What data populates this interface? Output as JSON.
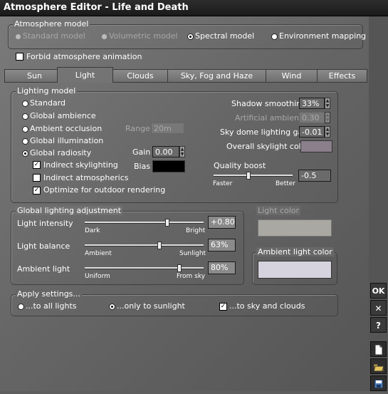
{
  "window": {
    "title": "Atmosphere Editor - Life and Death"
  },
  "atmosphere_model": {
    "label": "Atmosphere model",
    "options": [
      "Standard model",
      "Volumetric model",
      "Spectral model",
      "Environment mapping"
    ],
    "selected": "Spectral model"
  },
  "forbid_animation": {
    "label": "Forbid atmosphere animation",
    "checked": false
  },
  "tabs": [
    "Sun",
    "Light",
    "Clouds",
    "Sky, Fog and Haze",
    "Wind",
    "Effects"
  ],
  "active_tab": "Light",
  "lighting_model": {
    "label": "Lighting model",
    "options": [
      "Standard",
      "Global ambience",
      "Ambient occlusion",
      "Global illumination",
      "Global radiosity"
    ],
    "selected": "Global radiosity",
    "range_label": "Range",
    "range_value": "20m",
    "gain_label": "Gain",
    "gain_value": "0.00",
    "bias_label": "Bias",
    "bias_color": "#000000",
    "checks": [
      {
        "label": "Indirect skylighting",
        "checked": true
      },
      {
        "label": "Indirect atmospherics",
        "checked": false
      },
      {
        "label": "Optimize for outdoor rendering",
        "checked": true
      }
    ],
    "shadow_smoothing_label": "Shadow smoothing",
    "shadow_smoothing_value": "33%",
    "artificial_ambience_label": "Artificial ambience",
    "artificial_ambience_value": "0.30",
    "sky_dome_label": "Sky dome lighting gain",
    "sky_dome_value": "-0.01",
    "overall_skylight_label": "Overall skylight color",
    "overall_skylight_color": "#8a7f8b",
    "quality_boost_label": "Quality boost",
    "quality_boost_value": "-0.5",
    "quality_boost_level": 0.4,
    "faster_label": "Faster",
    "better_label": "Better"
  },
  "global_adjust": {
    "label": "Global lighting adjustment",
    "rows": [
      {
        "label": "Light intensity",
        "value": "+0.80",
        "min_label": "Dark",
        "max_label": "Bright",
        "level": 0.7
      },
      {
        "label": "Light balance",
        "value": "63%",
        "min_label": "Ambient",
        "max_label": "Sunlight",
        "level": 0.63
      },
      {
        "label": "Ambient light",
        "value": "80%",
        "min_label": "Uniform",
        "max_label": "From sky",
        "level": 0.8
      }
    ]
  },
  "light_color": {
    "label": "Light color",
    "color": "#a9a8a3"
  },
  "ambient_light_color": {
    "label": "Ambient light color",
    "color": "#d6d3de"
  },
  "apply_settings": {
    "label": "Apply settings...",
    "options": [
      "...to all lights",
      "...only to sunlight",
      "...to sky and clouds"
    ],
    "selected": "...only to sunlight",
    "sky_checked": true
  },
  "sidebar": {
    "ok": "OK",
    "cancel": "✕",
    "help": "?"
  }
}
